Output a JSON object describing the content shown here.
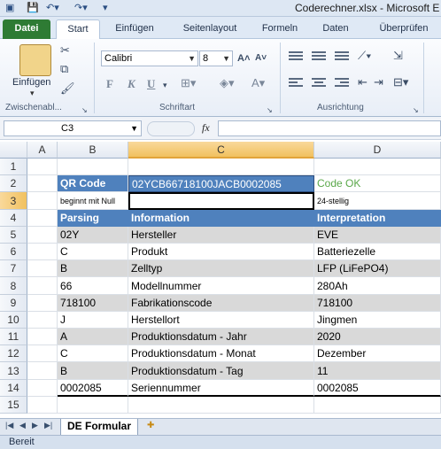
{
  "window": {
    "title": "Coderechner.xlsx - Microsoft E"
  },
  "ribbon": {
    "tabs": [
      "Datei",
      "Start",
      "Einfügen",
      "Seitenlayout",
      "Formeln",
      "Daten",
      "Überprüfen"
    ],
    "paste_label": "Einfügen",
    "groups": {
      "clipboard": "Zwischenabl...",
      "font": "Schriftart",
      "alignment": "Ausrichtung"
    },
    "font_name": "Calibri",
    "font_size": "8",
    "bold": "F",
    "italic": "K",
    "underline": "U"
  },
  "formula_bar": {
    "name_box": "C3",
    "fx": "fx",
    "formula": ""
  },
  "grid": {
    "columns": [
      "A",
      "B",
      "C",
      "D"
    ],
    "selected_column": "C",
    "selected_row": "3",
    "rows": [
      {
        "n": "1",
        "b": "",
        "c": "",
        "d": ""
      },
      {
        "n": "2",
        "b": "QR Code",
        "c": "02YCB66718100JACB0002085",
        "d": "Code OK"
      },
      {
        "n": "3",
        "b": "beginnt mit Null",
        "c": "",
        "d": "24-stellig"
      },
      {
        "n": "4",
        "b": "Parsing",
        "c": "Information",
        "d": "Interpretation"
      },
      {
        "n": "5",
        "b": "02Y",
        "c": "Hersteller",
        "d": "EVE"
      },
      {
        "n": "6",
        "b": "C",
        "c": "Produkt",
        "d": "Batteriezelle"
      },
      {
        "n": "7",
        "b": "B",
        "c": "Zelltyp",
        "d": "LFP (LiFePO4)"
      },
      {
        "n": "8",
        "b": "66",
        "c": "Modellnummer",
        "d": "280Ah"
      },
      {
        "n": "9",
        "b": "718100",
        "c": "Fabrikationscode",
        "d": "718100"
      },
      {
        "n": "10",
        "b": "J",
        "c": "Herstellort",
        "d": "Jingmen"
      },
      {
        "n": "11",
        "b": "A",
        "c": "Produktionsdatum - Jahr",
        "d": "2020"
      },
      {
        "n": "12",
        "b": "C",
        "c": "Produktionsdatum - Monat",
        "d": "Dezember"
      },
      {
        "n": "13",
        "b": "B",
        "c": "Produktionsdatum - Tag",
        "d": "11"
      },
      {
        "n": "14",
        "b": "0002085",
        "c": "Seriennummer",
        "d": "0002085"
      },
      {
        "n": "15",
        "b": "",
        "c": "",
        "d": ""
      }
    ]
  },
  "sheet_tabs": {
    "active": "DE Formular"
  },
  "status": {
    "text": "Bereit"
  },
  "colors": {
    "header_blue": "#4f81bd",
    "row_shade": "#d9d9d9",
    "ok_green": "#5aa84a",
    "datei_green": "#2e7b34"
  }
}
